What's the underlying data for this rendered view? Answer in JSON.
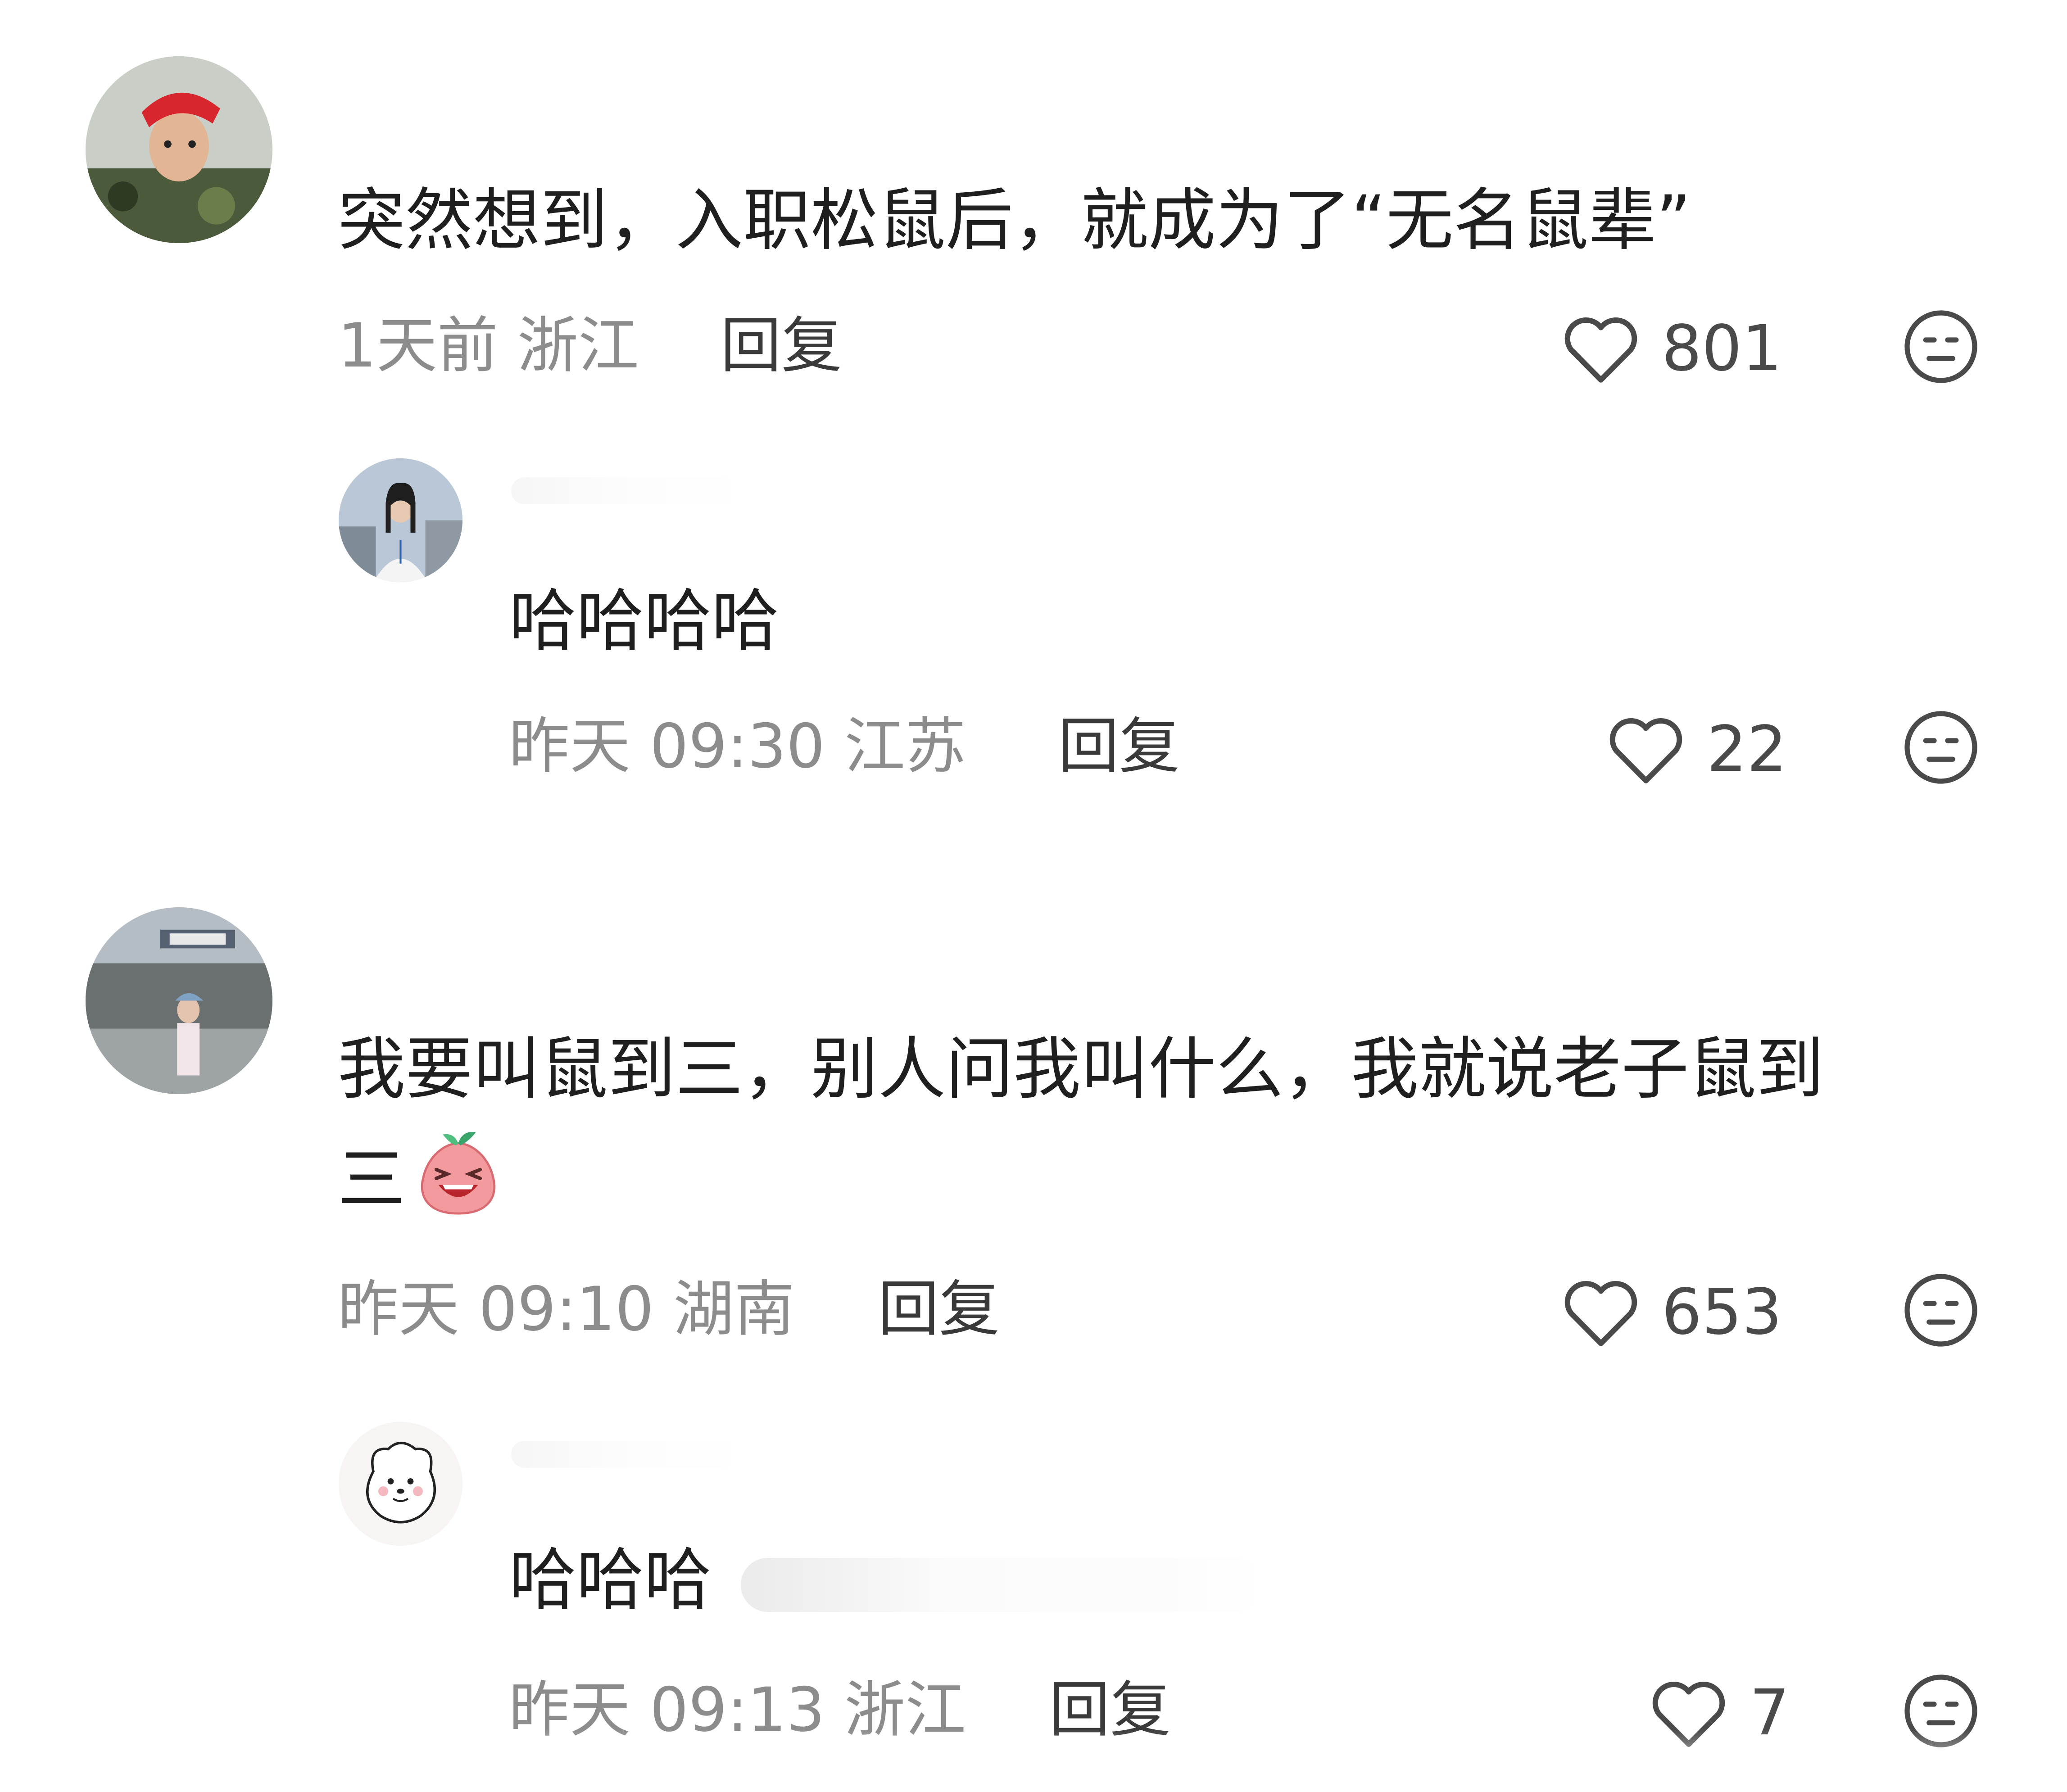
{
  "comments": [
    {
      "text": "突然想到，入职松鼠后，就成为了“无名鼠辈”",
      "meta": "1天前 浙江",
      "reply": "回复",
      "likes": "801"
    },
    {
      "text": "哈哈哈哈",
      "meta": "昨天 09:30 江苏",
      "reply": "回复",
      "likes": "22"
    },
    {
      "text_line1": "我要叫鼠到三，别人问我叫什么，我就说老子鼠到",
      "text_line2": "三",
      "emoji": "laughing-peach-emoji",
      "meta": "昨天 09:10 湖南",
      "reply": "回复",
      "likes": "653"
    },
    {
      "text": "哈哈哈",
      "meta": "昨天 09:13 浙江",
      "reply": "回复",
      "likes": "7"
    }
  ],
  "icons": {
    "like": "heart-outline-icon",
    "dislike": "meh-face-icon"
  },
  "colors": {
    "meta_gray": "#8c8c8c",
    "text": "#1f1f1f",
    "icon_stroke": "#4a4a4a"
  }
}
